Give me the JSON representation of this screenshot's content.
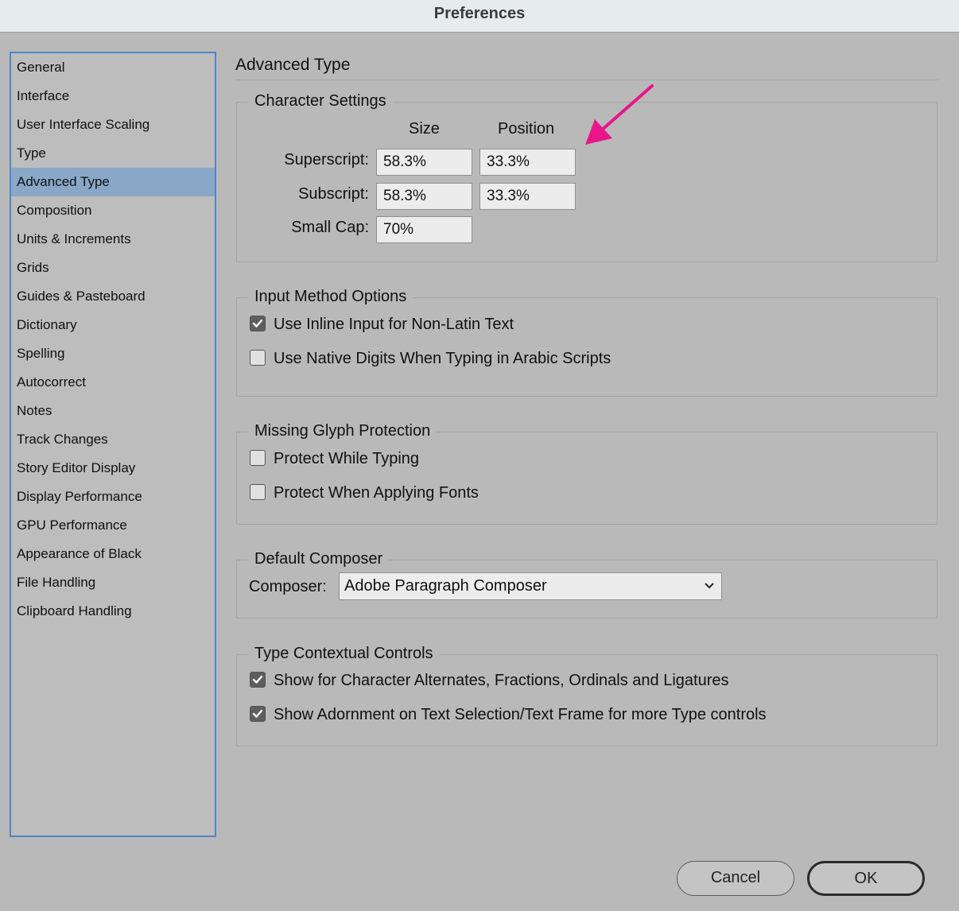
{
  "window": {
    "title": "Preferences"
  },
  "sidebar": {
    "items": [
      {
        "label": "General"
      },
      {
        "label": "Interface"
      },
      {
        "label": "User Interface Scaling"
      },
      {
        "label": "Type"
      },
      {
        "label": "Advanced Type",
        "selected": true
      },
      {
        "label": "Composition"
      },
      {
        "label": "Units & Increments"
      },
      {
        "label": "Grids"
      },
      {
        "label": "Guides & Pasteboard"
      },
      {
        "label": "Dictionary"
      },
      {
        "label": "Spelling"
      },
      {
        "label": "Autocorrect"
      },
      {
        "label": "Notes"
      },
      {
        "label": "Track Changes"
      },
      {
        "label": "Story Editor Display"
      },
      {
        "label": "Display Performance"
      },
      {
        "label": "GPU Performance"
      },
      {
        "label": "Appearance of Black"
      },
      {
        "label": "File Handling"
      },
      {
        "label": "Clipboard Handling"
      }
    ]
  },
  "main": {
    "title": "Advanced Type",
    "character_settings": {
      "legend": "Character Settings",
      "size_header": "Size",
      "position_header": "Position",
      "superscript": {
        "label": "Superscript:",
        "size": "58.3%",
        "position": "33.3%"
      },
      "subscript": {
        "label": "Subscript:",
        "size": "58.3%",
        "position": "33.3%"
      },
      "small_cap": {
        "label": "Small Cap:",
        "size": "70%"
      }
    },
    "input_method": {
      "legend": "Input Method Options",
      "options": [
        {
          "label": "Use Inline Input for Non-Latin Text",
          "checked": true
        },
        {
          "label": "Use Native Digits When Typing in Arabic Scripts",
          "checked": false
        }
      ]
    },
    "missing_glyph": {
      "legend": "Missing Glyph Protection",
      "options": [
        {
          "label": "Protect While Typing",
          "checked": false
        },
        {
          "label": "Protect When Applying Fonts",
          "checked": false
        }
      ]
    },
    "default_composer": {
      "legend": "Default Composer",
      "label": "Composer:",
      "value": "Adobe Paragraph Composer"
    },
    "type_contextual": {
      "legend": "Type Contextual Controls",
      "options": [
        {
          "label": "Show for Character Alternates, Fractions, Ordinals and Ligatures",
          "checked": true
        },
        {
          "label": "Show Adornment on Text Selection/Text Frame for more Type controls",
          "checked": true
        }
      ]
    }
  },
  "buttons": {
    "cancel": "Cancel",
    "ok": "OK"
  },
  "annotation": {
    "arrow_color": "#e8168a"
  },
  "colors": {
    "selection": "#8aa7c7",
    "sidebar_border": "#4f86c6"
  }
}
